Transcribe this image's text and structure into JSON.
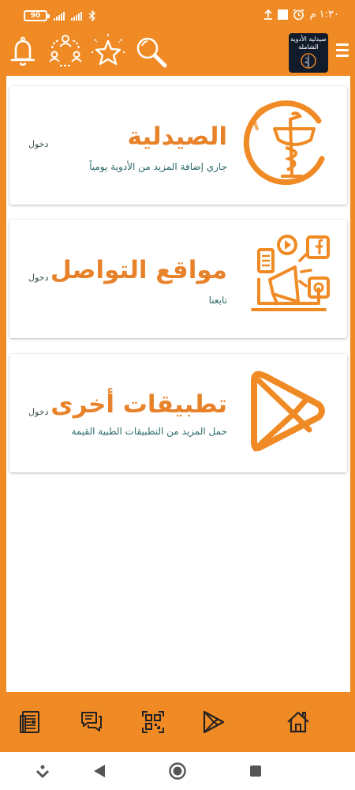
{
  "status_bar": {
    "battery": "90",
    "time": "١:٣٠ م"
  },
  "header": {
    "app_logo_text": "صيدلية الأدوية الشاملة",
    "icons": [
      "bell-icon",
      "users-exchange-icon",
      "star-icon",
      "search-icon",
      "menu-icon"
    ]
  },
  "cards": [
    {
      "title": "الصيدلية",
      "subtitle": "جاري إضافة المزيد من الأدوية يومياً",
      "action": "دخول",
      "icon": "caduceus-icon"
    },
    {
      "title": "مواقع التواصل",
      "subtitle": "تابعنا",
      "action": "دخول",
      "icon": "social-media-icon"
    },
    {
      "title": "تطبيقات أخرى",
      "subtitle": "حمل المزيد من التطبيقات الطبية القيمة",
      "action": "دخول",
      "icon": "play-store-icon"
    }
  ],
  "bottom_nav": {
    "icons": [
      "newspaper-icon",
      "chat-icon",
      "qr-code-icon",
      "play-icon",
      "home-icon"
    ]
  },
  "colors": {
    "accent": "#f08a24",
    "title": "#e8822a",
    "subtitle": "#2c6a6a"
  }
}
